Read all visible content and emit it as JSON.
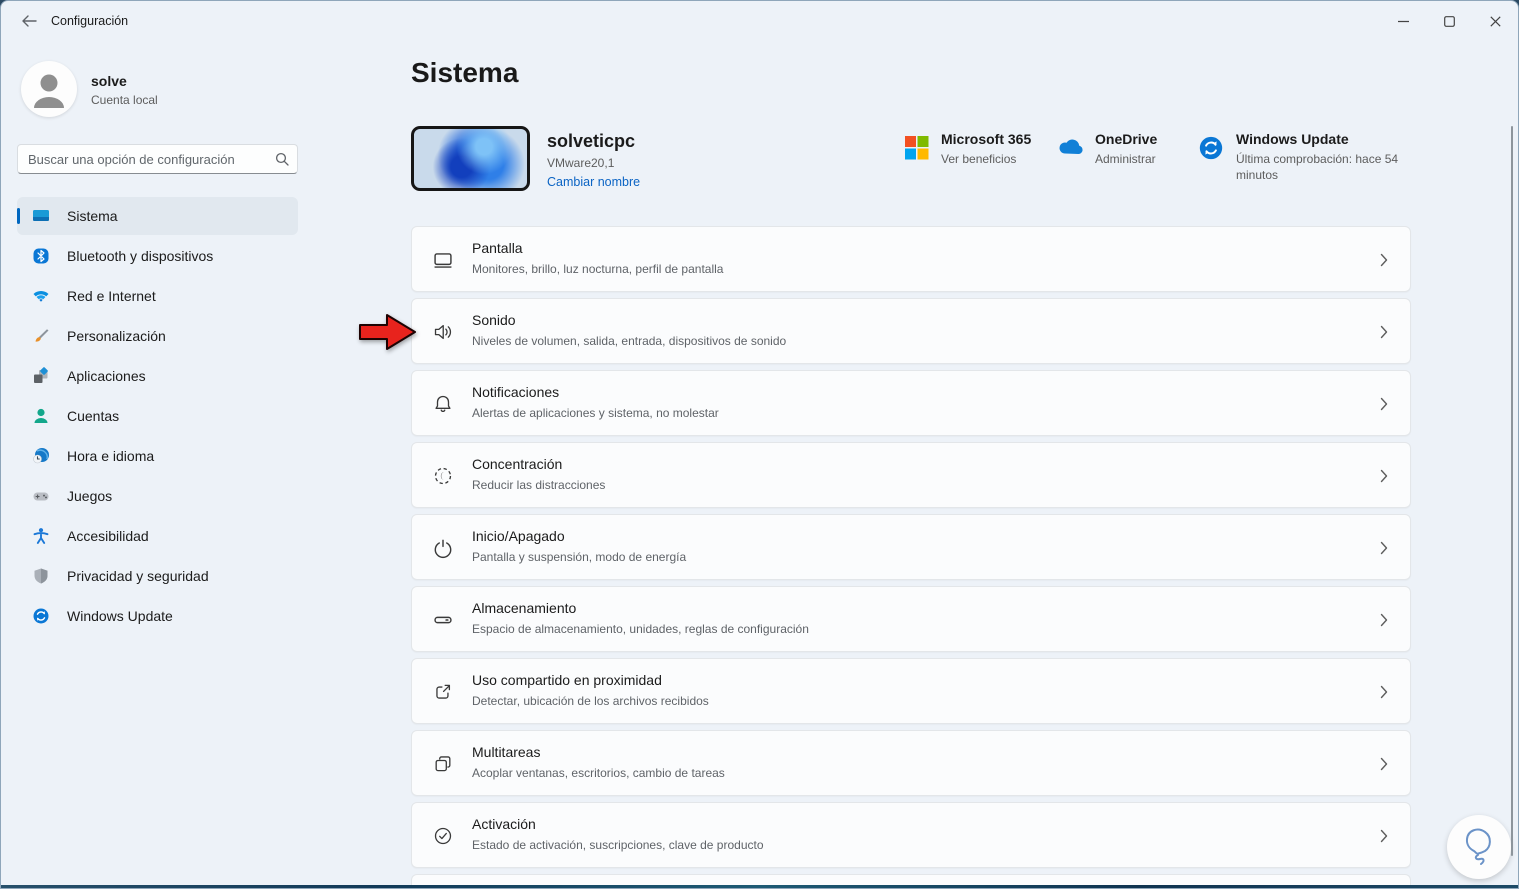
{
  "titlebar": {
    "title": "Configuración"
  },
  "sidebar": {
    "user": {
      "name": "solve",
      "account_type": "Cuenta local"
    },
    "search_placeholder": "Buscar una opción de configuración",
    "items": [
      {
        "label": "Sistema"
      },
      {
        "label": "Bluetooth y dispositivos"
      },
      {
        "label": "Red e Internet"
      },
      {
        "label": "Personalización"
      },
      {
        "label": "Aplicaciones"
      },
      {
        "label": "Cuentas"
      },
      {
        "label": "Hora e idioma"
      },
      {
        "label": "Juegos"
      },
      {
        "label": "Accesibilidad"
      },
      {
        "label": "Privacidad y seguridad"
      },
      {
        "label": "Windows Update"
      }
    ]
  },
  "main": {
    "title": "Sistema",
    "device": {
      "name": "solveticpc",
      "model": "VMware20,1",
      "rename_link": "Cambiar nombre"
    },
    "quick_links": [
      {
        "title": "Microsoft 365",
        "subtitle": "Ver beneficios"
      },
      {
        "title": "OneDrive",
        "subtitle": "Administrar"
      },
      {
        "title": "Windows Update",
        "subtitle": "Última comprobación: hace 54 minutos"
      }
    ],
    "settings": [
      {
        "title": "Pantalla",
        "subtitle": "Monitores, brillo, luz nocturna, perfil de pantalla"
      },
      {
        "title": "Sonido",
        "subtitle": "Niveles de volumen, salida, entrada, dispositivos de sonido"
      },
      {
        "title": "Notificaciones",
        "subtitle": "Alertas de aplicaciones y sistema, no molestar"
      },
      {
        "title": "Concentración",
        "subtitle": "Reducir las distracciones"
      },
      {
        "title": "Inicio/Apagado",
        "subtitle": "Pantalla y suspensión, modo de energía"
      },
      {
        "title": "Almacenamiento",
        "subtitle": "Espacio de almacenamiento, unidades, reglas de configuración"
      },
      {
        "title": "Uso compartido en proximidad",
        "subtitle": "Detectar, ubicación de los archivos recibidos"
      },
      {
        "title": "Multitareas",
        "subtitle": "Acoplar ventanas, escritorios, cambio de tareas"
      },
      {
        "title": "Activación",
        "subtitle": "Estado de activación, suscripciones, clave de producto"
      }
    ]
  },
  "colors": {
    "accent": "#0067c0",
    "link": "#0b64c4",
    "arrow_red": "#e8231d",
    "ms_red": "#f25022",
    "ms_green": "#7fba00",
    "ms_blue": "#00a4ef",
    "ms_yellow": "#ffb900"
  }
}
